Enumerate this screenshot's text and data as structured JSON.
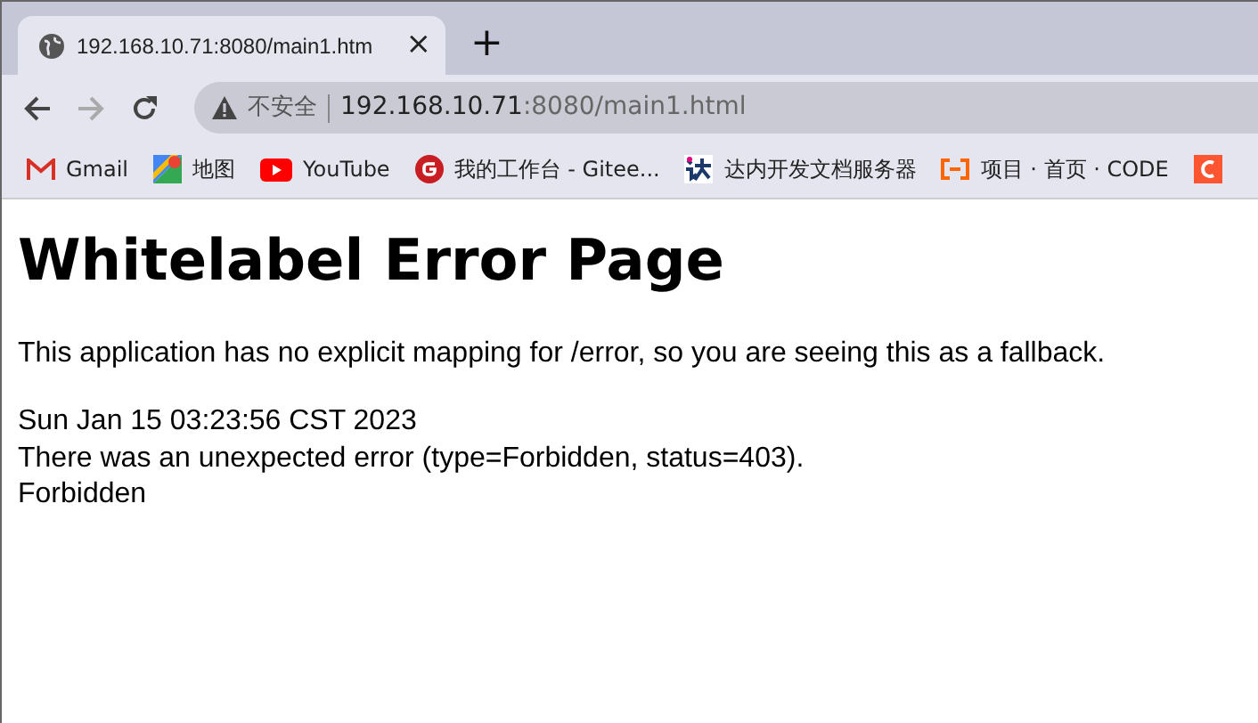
{
  "tabs": [
    {
      "title": "192.168.10.71:8080/main1.htm",
      "selected": true,
      "close": "×"
    }
  ],
  "new_tab": "+",
  "address_bar": {
    "security": "不安全",
    "host": "192.168.10.71",
    "path": ":8080/main1.html"
  },
  "bookmarks": [
    {
      "kind": "gmail",
      "label": "Gmail"
    },
    {
      "kind": "maps",
      "label": "地图"
    },
    {
      "kind": "youtube",
      "label": "YouTube"
    },
    {
      "kind": "gitee",
      "label": "我的工作台 - Gitee..."
    },
    {
      "kind": "da",
      "label": "达内开发文档服务器"
    },
    {
      "kind": "bracket",
      "label": "项目 · 首页 · CODE"
    },
    {
      "kind": "csdn"
    }
  ],
  "page": {
    "heading": "Whitelabel Error Page",
    "message": "This application has no explicit mapping for /error, so you are seeing this as a fallback.",
    "lines": [
      "Sun Jan 15 03:23:56 CST 2023",
      "There was an unexpected error (type=Forbidden, status=403).",
      "Forbidden"
    ]
  }
}
